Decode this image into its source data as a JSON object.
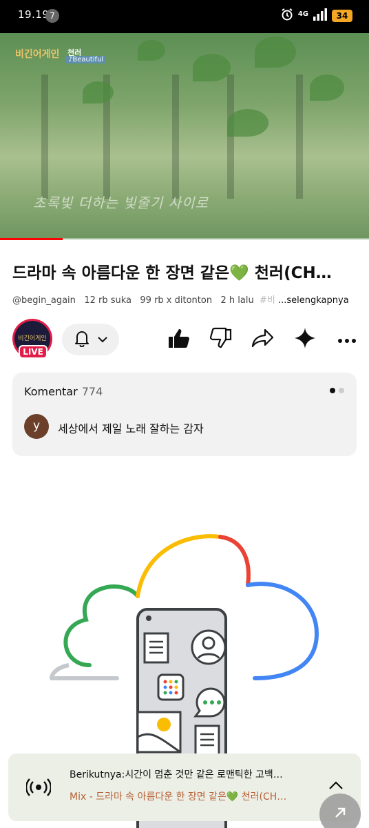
{
  "status_bar": {
    "time": "19.19",
    "notif_count": "7",
    "network": "4G",
    "battery": "34"
  },
  "video": {
    "logo_text": "비긴어게인",
    "artist": "천러",
    "song": "♪Beautiful",
    "subtitle": "초록빛 더하는 빛줄기 사이로",
    "progress": 0.17
  },
  "details": {
    "title": "드라마 속 아름다운 한 장면 같은💚 천러(CH…",
    "channel": "@begin_again",
    "likes": "12 rb suka",
    "views": "99 rb x ditonton",
    "age": "2 h lalu",
    "hashtag": "#비",
    "more": "...selengkapnya"
  },
  "channel": {
    "avatar_text": "비긴어게인",
    "live_label": "LIVE"
  },
  "actions": {
    "bell": "notification-bell",
    "like": "like",
    "dislike": "dislike",
    "share": "share",
    "remix": "sparkle",
    "more": "more"
  },
  "comments": {
    "label": "Komentar",
    "count": "774",
    "first_avatar": "y",
    "first_comment": "세상에서 제일 노래 잘하는 감자"
  },
  "next_up": {
    "line1": "Berikutnya:시간이 멈춘 것만 같은 로맨틱한 고백…",
    "line2": "Mix - 드라마 속 아름다운 한 장면 같은💚 천러(CH…"
  },
  "colors": {
    "accent_red": "#ff0000",
    "live_red": "#e11d48",
    "mix_text": "#b65f35",
    "google_blue": "#4285f4",
    "google_red": "#ea4335",
    "google_yellow": "#fbbc04",
    "google_green": "#34a853"
  }
}
